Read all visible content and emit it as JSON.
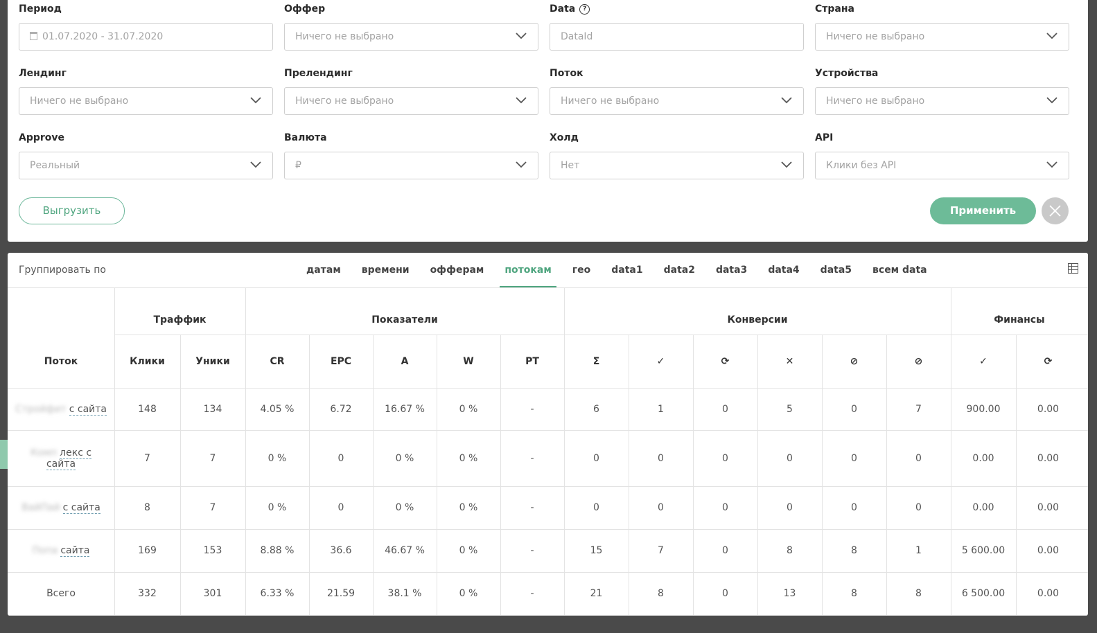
{
  "filters": {
    "period": {
      "label": "Период",
      "value": "01.07.2020 - 31.07.2020"
    },
    "offer": {
      "label": "Оффер",
      "value": "Ничего не выбрано"
    },
    "data": {
      "label": "Data",
      "placeholder": "DataId"
    },
    "country": {
      "label": "Страна",
      "value": "Ничего не выбрано"
    },
    "landing": {
      "label": "Лендинг",
      "value": "Ничего не выбрано"
    },
    "prelanding": {
      "label": "Прелендинг",
      "value": "Ничего не выбрано"
    },
    "stream": {
      "label": "Поток",
      "value": "Ничего не выбрано"
    },
    "devices": {
      "label": "Устройства",
      "value": "Ничего не выбрано"
    },
    "approve": {
      "label": "Approve",
      "value": "Реальный"
    },
    "currency": {
      "label": "Валюта",
      "value": "₽"
    },
    "hold": {
      "label": "Холд",
      "value": "Нет"
    },
    "api": {
      "label": "API",
      "value": "Клики без API"
    },
    "export_label": "Выгрузить",
    "apply_label": "Применить"
  },
  "report": {
    "group_by_label": "Группировать по",
    "tabs": [
      "датам",
      "времени",
      "офферам",
      "потокам",
      "гео",
      "data1",
      "data2",
      "data3",
      "data4",
      "data5",
      "всем data"
    ],
    "active_tab": "потокам",
    "groups": {
      "traffic": "Траффик",
      "metrics": "Показатели",
      "conversions": "Конверсии",
      "finance": "Финансы"
    },
    "columns": [
      "Поток",
      "Клики",
      "Уники",
      "CR",
      "EPC",
      "A",
      "W",
      "PT",
      "Σ",
      "✓",
      "⟳",
      "✕",
      "⊘",
      "⊘",
      "✓",
      "⟳"
    ],
    "rows": [
      {
        "name_hidden": "Стройфит",
        "name_visible": "с сайта",
        "cells": [
          "148",
          "134",
          "4.05 %",
          "6.72",
          "16.67 %",
          "0 %",
          "-",
          "6",
          "1",
          "0",
          "5",
          "0",
          "7",
          "900.00",
          "0.00"
        ]
      },
      {
        "name_hidden": "Комп",
        "name_visible": "лекс с сайта",
        "cells": [
          "7",
          "7",
          "0 %",
          "0",
          "0 %",
          "0 %",
          "-",
          "0",
          "0",
          "0",
          "0",
          "0",
          "0",
          "0.00",
          "0.00"
        ]
      },
      {
        "name_hidden": "ВайПай",
        "name_visible": "с сайта",
        "cells": [
          "8",
          "7",
          "0 %",
          "0",
          "0 %",
          "0 %",
          "-",
          "0",
          "0",
          "0",
          "0",
          "0",
          "0",
          "0.00",
          "0.00"
        ]
      },
      {
        "name_hidden": "Попа",
        "name_visible": "сайта",
        "cells": [
          "169",
          "153",
          "8.88 %",
          "36.6",
          "46.67 %",
          "0 %",
          "-",
          "15",
          "7",
          "0",
          "8",
          "8",
          "1",
          "5 600.00",
          "0.00"
        ]
      }
    ],
    "total": {
      "name": "Всего",
      "cells": [
        "332",
        "301",
        "6.33 %",
        "21.59",
        "38.1 %",
        "0 %",
        "-",
        "21",
        "8",
        "0",
        "13",
        "8",
        "8",
        "6 500.00",
        "0.00"
      ]
    }
  }
}
